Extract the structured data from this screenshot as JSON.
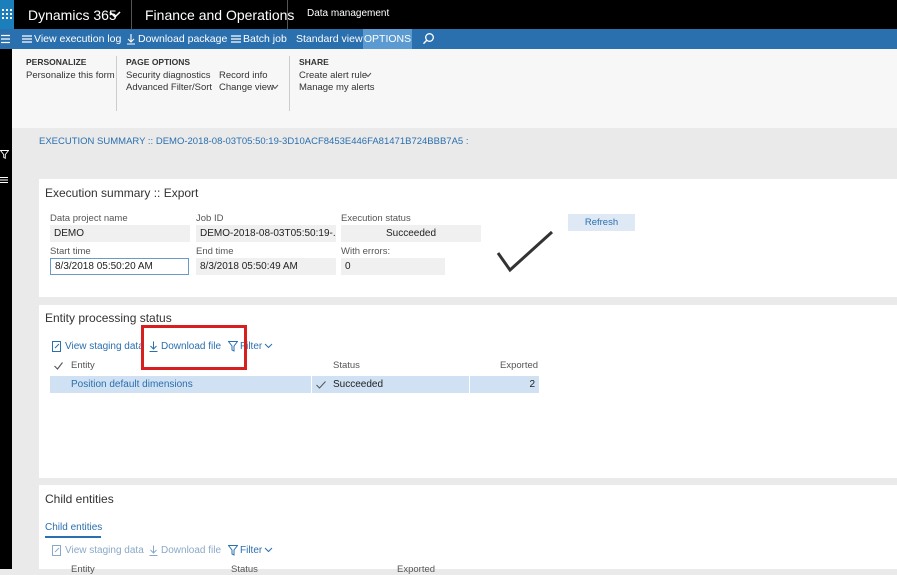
{
  "topbar": {
    "app_name": "Dynamics 365",
    "module": "Finance and Operations",
    "breadcrumb": "Data management"
  },
  "action_pane": {
    "view_execution_log": "View execution log",
    "download_package": "Download package",
    "batch_job": "Batch job",
    "standard_view": "Standard view",
    "options": "OPTIONS"
  },
  "ribbon": {
    "personalize": {
      "header": "PERSONALIZE",
      "items": [
        "Personalize this form"
      ]
    },
    "page_options": {
      "header": "PAGE OPTIONS",
      "items": [
        "Security diagnostics",
        "Advanced Filter/Sort",
        "Record info",
        "Change view"
      ]
    },
    "share": {
      "header": "SHARE",
      "items": [
        "Create alert rule",
        "Manage my alerts"
      ]
    }
  },
  "summary_header": "EXECUTION SUMMARY :: DEMO-2018-08-03T05:50:19-3D10ACF8453E446FA81471B724BBB7A5 :",
  "execution_summary": {
    "title": "Execution summary :: Export",
    "data_project_label": "Data project name",
    "data_project_value": "DEMO",
    "job_id_label": "Job ID",
    "job_id_value": "DEMO-2018-08-03T05:50:19-...",
    "execution_status_label": "Execution status",
    "execution_status_value": "Succeeded",
    "start_time_label": "Start time",
    "start_time_value": "8/3/2018 05:50:20 AM",
    "end_time_label": "End time",
    "end_time_value": "8/3/2018 05:50:49 AM",
    "with_errors_label": "With errors:",
    "with_errors_value": "0",
    "refresh": "Refresh"
  },
  "entity_processing": {
    "title": "Entity processing status",
    "view_staging": "View staging data",
    "download_file": "Download file",
    "filter": "Filter",
    "columns": {
      "entity": "Entity",
      "status": "Status",
      "exported": "Exported"
    },
    "rows": [
      {
        "entity": "Position default dimensions",
        "status": "Succeeded",
        "exported": "2"
      }
    ]
  },
  "child_entities": {
    "title": "Child entities",
    "tab": "Child entities",
    "view_staging": "View staging data",
    "download_file": "Download file",
    "filter": "Filter",
    "columns": {
      "entity": "Entity",
      "status": "Status",
      "exported": "Exported"
    }
  },
  "colors": {
    "accent": "#2a6fae",
    "highlight": "#d81f1f",
    "topbar": "#000000"
  }
}
